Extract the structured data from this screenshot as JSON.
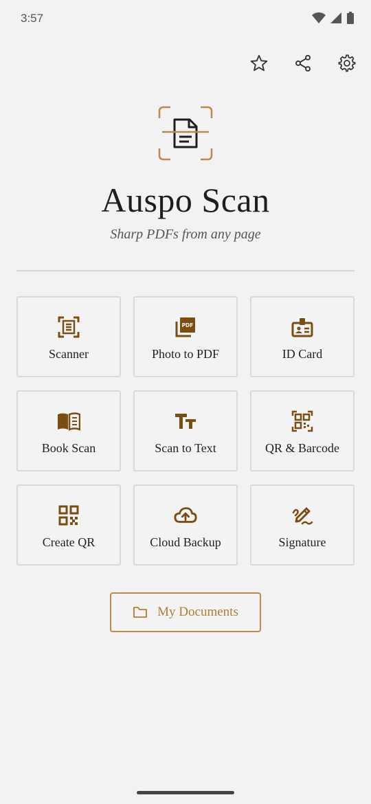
{
  "status_bar": {
    "time": "3:57"
  },
  "toolbar": {
    "favorite_icon": "star-icon",
    "share_icon": "share-icon",
    "settings_icon": "gear-icon"
  },
  "header": {
    "title": "Auspo Scan",
    "subtitle": "Sharp PDFs from any page"
  },
  "colors": {
    "accent": "#7a4e12",
    "accent_light": "#b98a4a",
    "background": "#f2f2f2"
  },
  "tiles": [
    {
      "label": "Scanner",
      "icon": "scanner-icon"
    },
    {
      "label": "Photo to PDF",
      "icon": "pdf-icon"
    },
    {
      "label": "ID Card",
      "icon": "id-card-icon"
    },
    {
      "label": "Book Scan",
      "icon": "book-icon"
    },
    {
      "label": "Scan to Text",
      "icon": "text-icon"
    },
    {
      "label": "QR & Barcode",
      "icon": "qr-scan-icon"
    },
    {
      "label": "Create QR",
      "icon": "qr-code-icon"
    },
    {
      "label": "Cloud Backup",
      "icon": "cloud-upload-icon"
    },
    {
      "label": "Signature",
      "icon": "signature-icon"
    }
  ],
  "documents_button": {
    "label": "My Documents",
    "icon": "folder-icon"
  }
}
